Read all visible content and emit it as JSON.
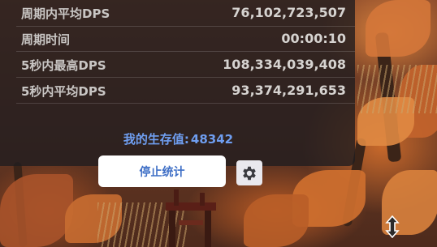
{
  "stats": [
    {
      "label": "周期内平均DPS",
      "value": "76,102,723,507"
    },
    {
      "label": "周期时间",
      "value": "00:00:10"
    },
    {
      "label": "5秒内最高DPS",
      "value": "108,334,039,408"
    },
    {
      "label": "5秒内平均DPS",
      "value": "93,374,291,653"
    }
  ],
  "survival": {
    "label": "我的生存值:",
    "value": "48342"
  },
  "buttons": {
    "stop_label": "停止统计"
  },
  "icons": {
    "settings": "gear-icon",
    "move": "move-arrows-icon"
  },
  "colors": {
    "panel_bg": "#211d1f",
    "accent": "#3f6fc6",
    "survival_text": "#6f9ef0"
  }
}
